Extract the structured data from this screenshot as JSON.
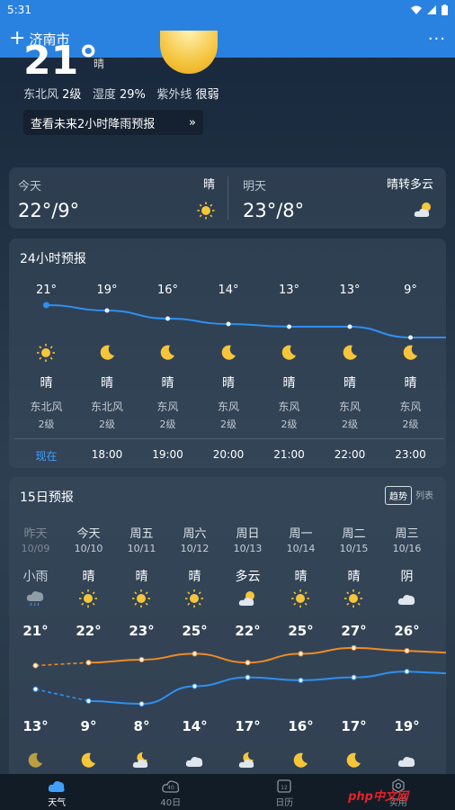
{
  "status": {
    "time": "5:31"
  },
  "header": {
    "city": "济南市"
  },
  "current": {
    "temp": "21°",
    "condition": "晴",
    "wind_label": "东北风",
    "wind_level": "2级",
    "humidity_label": "湿度",
    "humidity": "29%",
    "uv_label": "紫外线",
    "uv": "很弱",
    "rain_forecast_link": "查看未来2小时降雨预报"
  },
  "today": {
    "label": "今天",
    "condition": "晴",
    "range": "22°/9°",
    "icon": "sun-icon"
  },
  "tomorrow": {
    "label": "明天",
    "condition": "晴转多云",
    "range": "23°/8°",
    "icon": "partly-cloudy-icon"
  },
  "hourly": {
    "title": "24小时预报",
    "temps": [
      21,
      19,
      16,
      14,
      13,
      13,
      9
    ],
    "items": [
      {
        "temp": "21°",
        "icon": "sun-icon",
        "condition": "晴",
        "wind": "东北风",
        "level": "2级",
        "time": "现在"
      },
      {
        "temp": "19°",
        "icon": "moon-icon",
        "condition": "晴",
        "wind": "东北风",
        "level": "2级",
        "time": "18:00"
      },
      {
        "temp": "16°",
        "icon": "moon-icon",
        "condition": "晴",
        "wind": "东风",
        "level": "2级",
        "time": "19:00"
      },
      {
        "temp": "14°",
        "icon": "moon-icon",
        "condition": "晴",
        "wind": "东风",
        "level": "2级",
        "time": "20:00"
      },
      {
        "temp": "13°",
        "icon": "moon-icon",
        "condition": "晴",
        "wind": "东风",
        "level": "2级",
        "time": "21:00"
      },
      {
        "temp": "13°",
        "icon": "moon-icon",
        "condition": "晴",
        "wind": "东风",
        "level": "2级",
        "time": "22:00"
      },
      {
        "temp": "9°",
        "icon": "moon-icon",
        "condition": "晴",
        "wind": "东风",
        "level": "2级",
        "time": "23:00"
      }
    ]
  },
  "daily": {
    "title": "15日预报",
    "toggle_trend": "趋势",
    "toggle_list": "列表",
    "highs": [
      21,
      22,
      23,
      25,
      22,
      25,
      27,
      26
    ],
    "lows": [
      13,
      9,
      8,
      14,
      17,
      16,
      17,
      19
    ],
    "items": [
      {
        "weekday": "昨天",
        "date": "10/09",
        "condition": "小雨",
        "icon": "rain-icon",
        "high": "21°",
        "low": "13°",
        "night_icon": "moon-icon"
      },
      {
        "weekday": "今天",
        "date": "10/10",
        "condition": "晴",
        "icon": "sun-icon",
        "high": "22°",
        "low": "9°",
        "night_icon": "moon-icon"
      },
      {
        "weekday": "周五",
        "date": "10/11",
        "condition": "晴",
        "icon": "sun-icon",
        "high": "23°",
        "low": "8°",
        "night_icon": "partly-cloudy-night-icon"
      },
      {
        "weekday": "周六",
        "date": "10/12",
        "condition": "晴",
        "icon": "sun-icon",
        "high": "25°",
        "low": "14°",
        "night_icon": "cloud-icon"
      },
      {
        "weekday": "周日",
        "date": "10/13",
        "condition": "多云",
        "icon": "partly-cloudy-icon",
        "high": "22°",
        "low": "17°",
        "night_icon": "partly-cloudy-night-icon"
      },
      {
        "weekday": "周一",
        "date": "10/14",
        "condition": "晴",
        "icon": "sun-icon",
        "high": "25°",
        "low": "16°",
        "night_icon": "moon-icon"
      },
      {
        "weekday": "周二",
        "date": "10/15",
        "condition": "晴",
        "icon": "sun-icon",
        "high": "27°",
        "low": "17°",
        "night_icon": "moon-icon"
      },
      {
        "weekday": "周三",
        "date": "10/16",
        "condition": "阴",
        "icon": "cloud-icon",
        "high": "26°",
        "low": "19°",
        "night_icon": "cloud-icon"
      }
    ]
  },
  "tabs": [
    {
      "label": "天气",
      "icon": "weather-cloud-icon",
      "active": true
    },
    {
      "label": "40日",
      "icon": "forty-day-icon",
      "badge": "40",
      "active": false
    },
    {
      "label": "日历",
      "icon": "calendar-icon",
      "badge": "12",
      "active": false
    },
    {
      "label": "实用",
      "icon": "tools-icon",
      "active": false
    }
  ],
  "watermark": "php中文网",
  "colors": {
    "accent": "#2a82e0",
    "high_line": "#f08a24",
    "low_line": "#2f8ff0"
  }
}
